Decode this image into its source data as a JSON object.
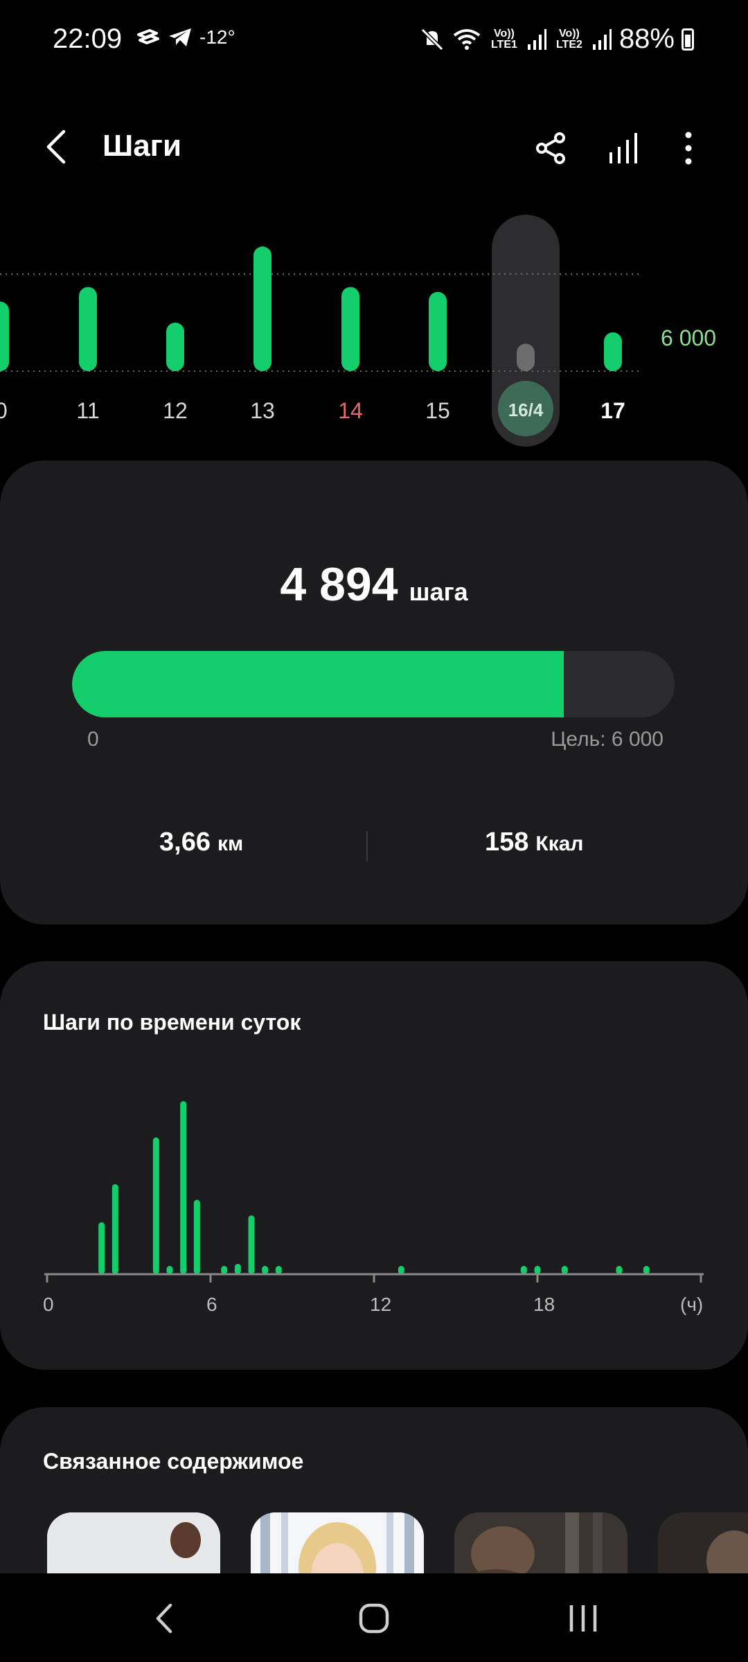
{
  "status_bar": {
    "time": "22:09",
    "temperature": "-12°",
    "net1": "Vo)) LTE1",
    "net2": "Vo)) LTE2",
    "battery": "88%"
  },
  "app_bar": {
    "title": "Шаги",
    "icons": [
      "back-arrow-icon",
      "share-icon",
      "bar-chart-icon",
      "more-vertical-icon"
    ]
  },
  "week_chart": {
    "goal_label": "6 000",
    "goal": 6000,
    "days": [
      {
        "label": "0",
        "steps": 4300,
        "style": "normal"
      },
      {
        "label": "11",
        "steps": 5200,
        "style": "normal"
      },
      {
        "label": "12",
        "steps": 3000,
        "style": "normal"
      },
      {
        "label": "13",
        "steps": 7700,
        "style": "normal"
      },
      {
        "label": "14",
        "steps": 5200,
        "style": "weekend"
      },
      {
        "label": "15",
        "steps": 4900,
        "style": "normal"
      },
      {
        "label": "16/4",
        "steps": 1700,
        "style": "selected"
      },
      {
        "label": "17",
        "steps": 2400,
        "style": "today"
      }
    ],
    "colors": {
      "bar": "#13ce6a",
      "weekend": "#e56b6b",
      "selected_pill": "#2d2d2f",
      "selected_badge": "#3d6b55"
    }
  },
  "summary": {
    "steps": "4 894",
    "steps_unit": "шага",
    "progress_fraction": 0.8157,
    "min_label": "0",
    "goal_label": "Цель: 6 000",
    "distance": "3,66",
    "distance_unit": "км",
    "calories": "158",
    "calories_unit": "Ккал"
  },
  "hourly": {
    "heading": "Шаги по времени суток",
    "tick_labels": [
      "0",
      "6",
      "12",
      "18",
      "(ч)"
    ],
    "x_ticks": [
      0,
      6,
      12,
      18
    ],
    "x_range": [
      0,
      24
    ],
    "bars": [
      {
        "h": 2.0,
        "v": 300
      },
      {
        "h": 2.5,
        "v": 520
      },
      {
        "h": 4.0,
        "v": 790
      },
      {
        "h": 4.5,
        "v": 30
      },
      {
        "h": 5.0,
        "v": 1000
      },
      {
        "h": 5.5,
        "v": 430
      },
      {
        "h": 6.5,
        "v": 30
      },
      {
        "h": 7.0,
        "v": 60
      },
      {
        "h": 7.5,
        "v": 340
      },
      {
        "h": 8.0,
        "v": 30
      },
      {
        "h": 8.5,
        "v": 30
      },
      {
        "h": 13.0,
        "v": 30
      },
      {
        "h": 17.5,
        "v": 30
      },
      {
        "h": 18.0,
        "v": 30
      },
      {
        "h": 19.0,
        "v": 30
      },
      {
        "h": 21.0,
        "v": 30
      },
      {
        "h": 22.0,
        "v": 30
      }
    ]
  },
  "related": {
    "heading": "Связанное содержимое",
    "items": [
      {
        "name": "fitness-woman-image"
      },
      {
        "name": "smiling-woman-image"
      },
      {
        "name": "gym-man-image"
      },
      {
        "name": "gym-partial-image"
      }
    ]
  },
  "nav_bar": {
    "icons": [
      "nav-back-icon",
      "nav-home-icon",
      "nav-recents-icon"
    ]
  }
}
